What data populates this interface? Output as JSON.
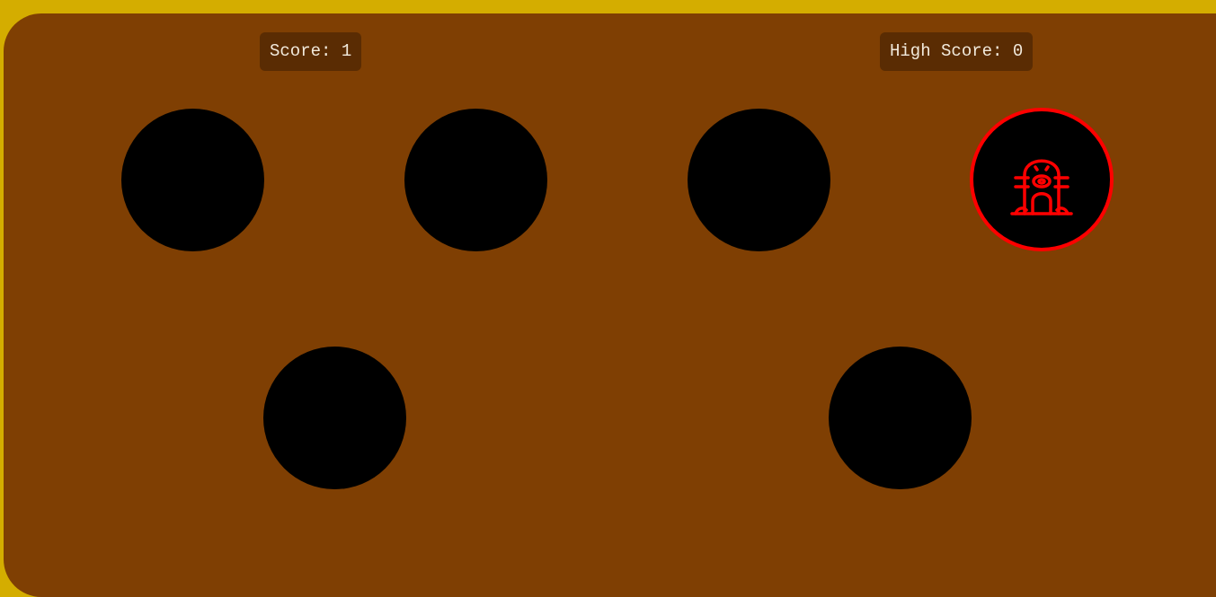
{
  "scoreboard": {
    "score_label": "Score:",
    "score_value": "1",
    "high_score_label": "High Score:",
    "high_score_value": "0"
  },
  "holes": [
    {
      "id": 1,
      "has_mole": false
    },
    {
      "id": 2,
      "has_mole": false
    },
    {
      "id": 3,
      "has_mole": false
    },
    {
      "id": 4,
      "has_mole": true
    },
    {
      "id": 5,
      "has_mole": false
    },
    {
      "id": 6,
      "has_mole": false
    }
  ],
  "colors": {
    "background": "#d4ad00",
    "board": "#7f3f03",
    "score_box": "#5a2c03",
    "score_text": "#f2eadc",
    "hole": "#000000",
    "active_mole": "#ff0000"
  },
  "icons": {
    "mole": "mole-icon"
  }
}
